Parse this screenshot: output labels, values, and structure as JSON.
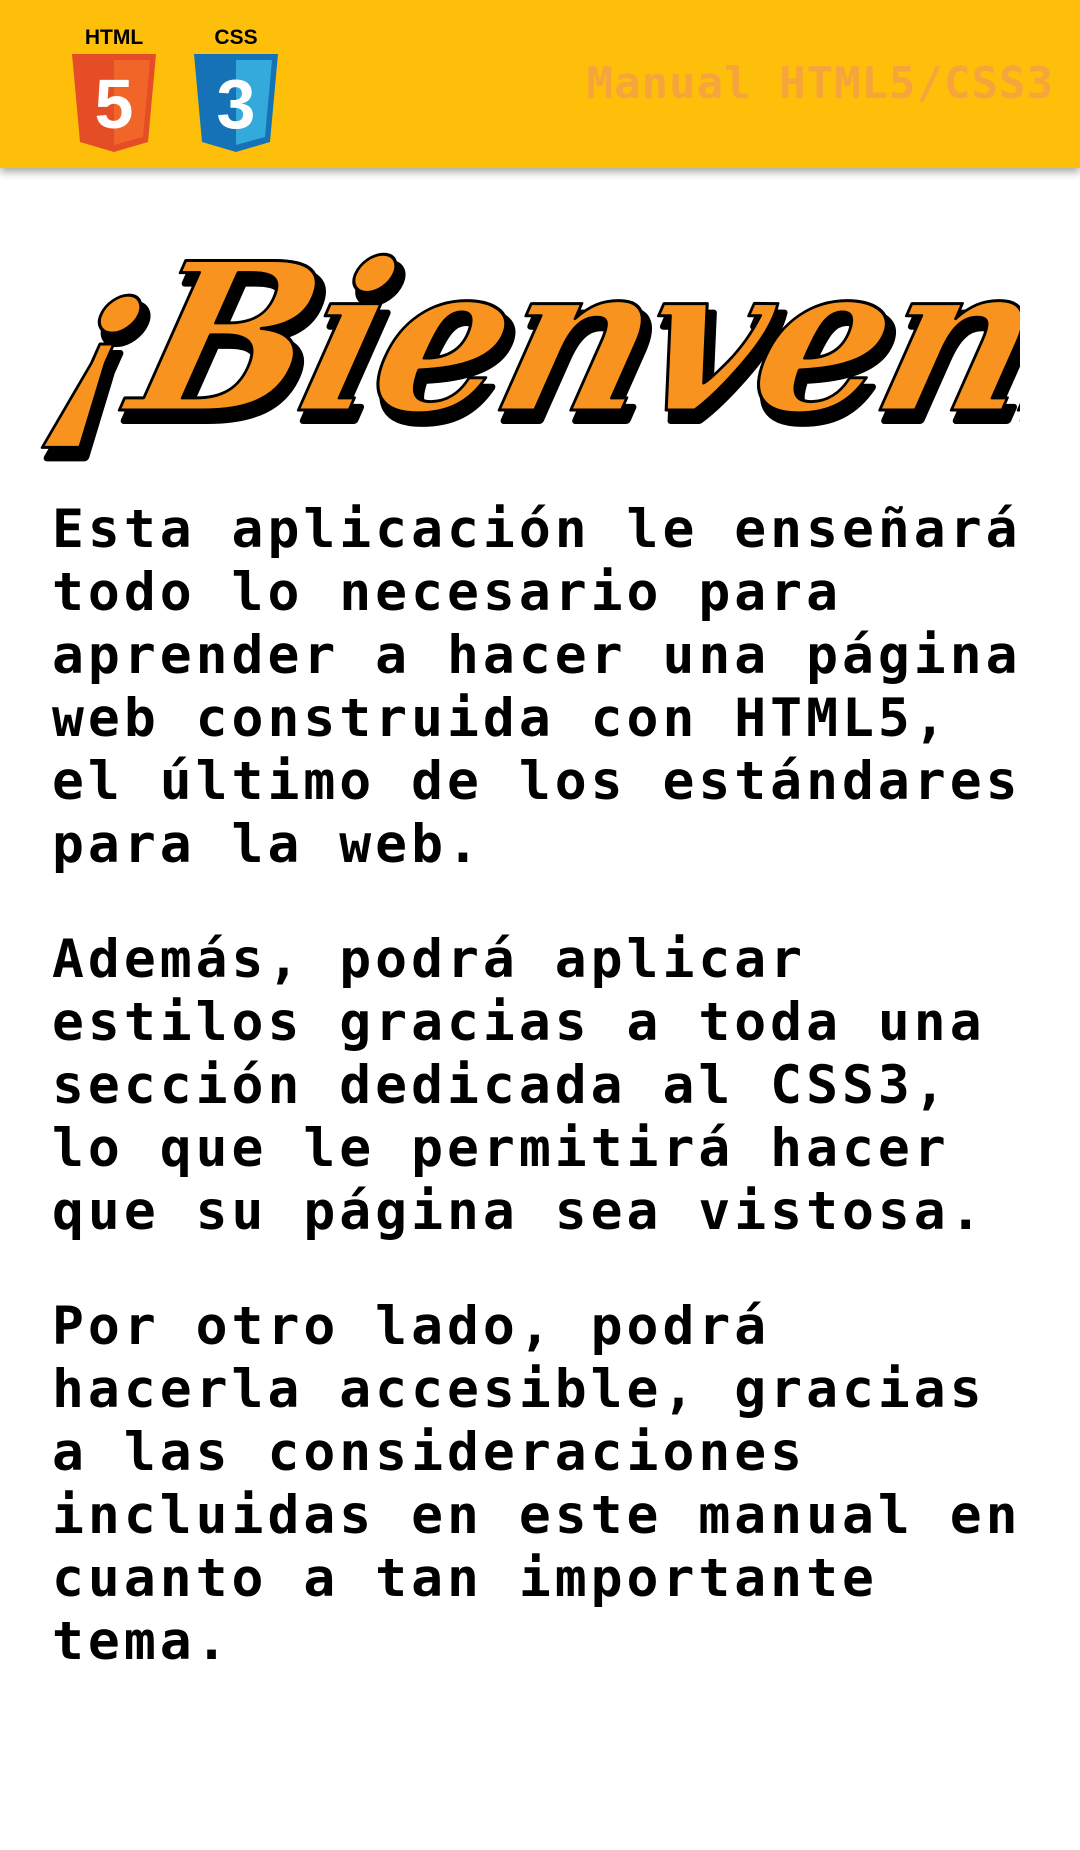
{
  "header": {
    "title": "Manual HTML5/CSS3",
    "logos": [
      {
        "label": "HTML",
        "number": "5",
        "color": "#e44d26",
        "icon": "html5-logo-icon"
      },
      {
        "label": "CSS",
        "number": "3",
        "color": "#1572b6",
        "icon": "css3-logo-icon"
      }
    ],
    "background": "#fdbf0a",
    "title_color": "#f6a43c"
  },
  "welcome": {
    "text": "¡Bienvenido!",
    "color": "#f7931e"
  },
  "content": {
    "paragraphs": [
      "Esta aplicación le enseñará todo lo necesario para aprender a hacer una página web construida con HTML5, el último de los estándares para la web.",
      "Además, podrá aplicar estilos gracias a toda una sección dedicada al CSS3, lo que le permitirá hacer que su página sea vistosa.",
      "Por otro lado, podrá hacerla accesible, gracias a las consideraciones incluidas en este manual en cuanto a tan importante tema."
    ]
  }
}
